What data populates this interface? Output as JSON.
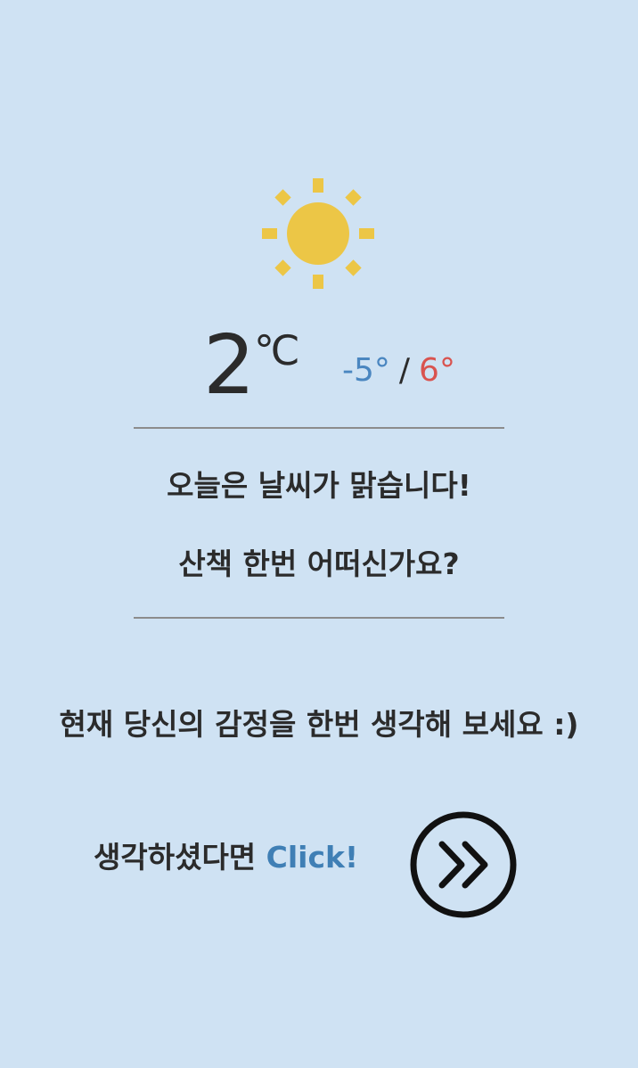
{
  "weather": {
    "icon": "sun-icon",
    "icon_color": "#ecc646",
    "current_temp": "2",
    "unit": "℃",
    "min_temp": "-5°",
    "range_separator": "/",
    "max_temp": "6°",
    "min_color": "#4a86c0",
    "max_color": "#d9534f"
  },
  "message": {
    "line1": "오늘은 날씨가 맑습니다!",
    "line2": "산책 한번 어떠신가요?"
  },
  "prompt": "현재 당신의 감정을 한번 생각해 보세요 :)",
  "cta": {
    "text": "생각하셨다면 ",
    "click_label": "Click!",
    "click_color": "#3f7fb5",
    "button_icon": "double-chevron-right-icon"
  },
  "background": "#cfe2f3"
}
